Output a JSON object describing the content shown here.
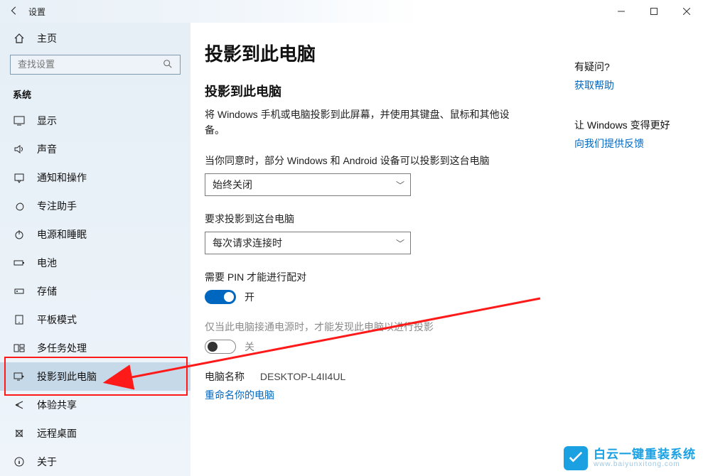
{
  "titlebar": {
    "title": "设置"
  },
  "sidebar": {
    "home": "主页",
    "search_placeholder": "查找设置",
    "section": "系统",
    "items": [
      {
        "icon": "display",
        "label": "显示"
      },
      {
        "icon": "sound",
        "label": "声音"
      },
      {
        "icon": "notify",
        "label": "通知和操作"
      },
      {
        "icon": "focus",
        "label": "专注助手"
      },
      {
        "icon": "power",
        "label": "电源和睡眠"
      },
      {
        "icon": "battery",
        "label": "电池"
      },
      {
        "icon": "storage",
        "label": "存储"
      },
      {
        "icon": "tablet",
        "label": "平板模式"
      },
      {
        "icon": "multitask",
        "label": "多任务处理"
      },
      {
        "icon": "project",
        "label": "投影到此电脑",
        "selected": true
      },
      {
        "icon": "share",
        "label": "体验共享"
      },
      {
        "icon": "remote",
        "label": "远程桌面"
      },
      {
        "icon": "about",
        "label": "关于"
      }
    ]
  },
  "main": {
    "h1": "投影到此电脑",
    "h2": "投影到此电脑",
    "desc": "将 Windows 手机或电脑投影到此屏幕，并使用其键盘、鼠标和其他设备。",
    "opt1_label": "当你同意时，部分 Windows 和 Android 设备可以投影到这台电脑",
    "opt1_value": "始终关闭",
    "opt2_label": "要求投影到这台电脑",
    "opt2_value": "每次请求连接时",
    "pin_label": "需要 PIN 才能进行配对",
    "pin_state": "开",
    "power_label": "仅当此电脑接通电源时，才能发现此电脑以进行投影",
    "power_state": "关",
    "pcname_label": "电脑名称",
    "pcname_value": "DESKTOP-L4II4UL",
    "rename_link": "重命名你的电脑"
  },
  "help": {
    "q": "有疑问?",
    "qlink": "获取帮助",
    "better": "让 Windows 变得更好",
    "feedback": "向我们提供反馈"
  },
  "watermark": {
    "line1": "白云一键重装系统",
    "line2": "www.baiyunxitong.com"
  }
}
